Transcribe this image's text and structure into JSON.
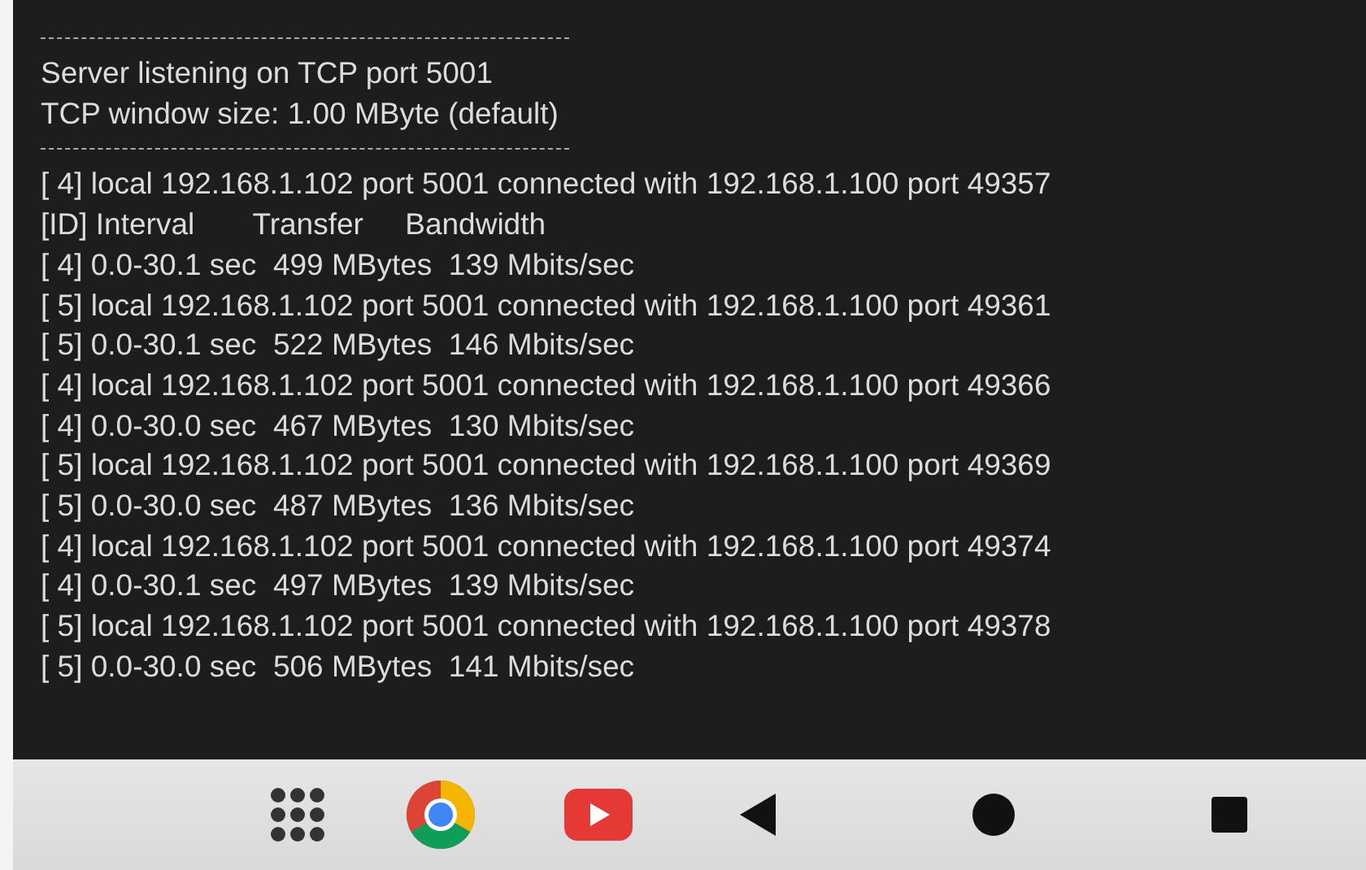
{
  "header": [
    "Server listening on TCP port 5001",
    "TCP window size: 1.00 MByte (default)"
  ],
  "output": [
    "[ 4] local 192.168.1.102 port 5001 connected with 192.168.1.100 port 49357",
    "[ID] Interval       Transfer     Bandwidth",
    "[ 4] 0.0-30.1 sec  499 MBytes  139 Mbits/sec",
    "[ 5] local 192.168.1.102 port 5001 connected with 192.168.1.100 port 49361",
    "[ 5] 0.0-30.1 sec  522 MBytes  146 Mbits/sec",
    "[ 4] local 192.168.1.102 port 5001 connected with 192.168.1.100 port 49366",
    "[ 4] 0.0-30.0 sec  467 MBytes  130 Mbits/sec",
    "[ 5] local 192.168.1.102 port 5001 connected with 192.168.1.100 port 49369",
    "[ 5] 0.0-30.0 sec  487 MBytes  136 Mbits/sec",
    "[ 4] local 192.168.1.102 port 5001 connected with 192.168.1.100 port 49374",
    "[ 4] 0.0-30.1 sec  497 MBytes  139 Mbits/sec",
    "[ 5] local 192.168.1.102 port 5001 connected with 192.168.1.100 port 49378",
    "[ 5] 0.0-30.0 sec  506 MBytes  141 Mbits/sec"
  ],
  "nav_bar": [
    {
      "kind": "apps"
    },
    {
      "kind": "browser"
    },
    {
      "kind": "video"
    },
    {
      "kind": "back"
    },
    {
      "kind": "home"
    },
    {
      "kind": "recents"
    }
  ]
}
